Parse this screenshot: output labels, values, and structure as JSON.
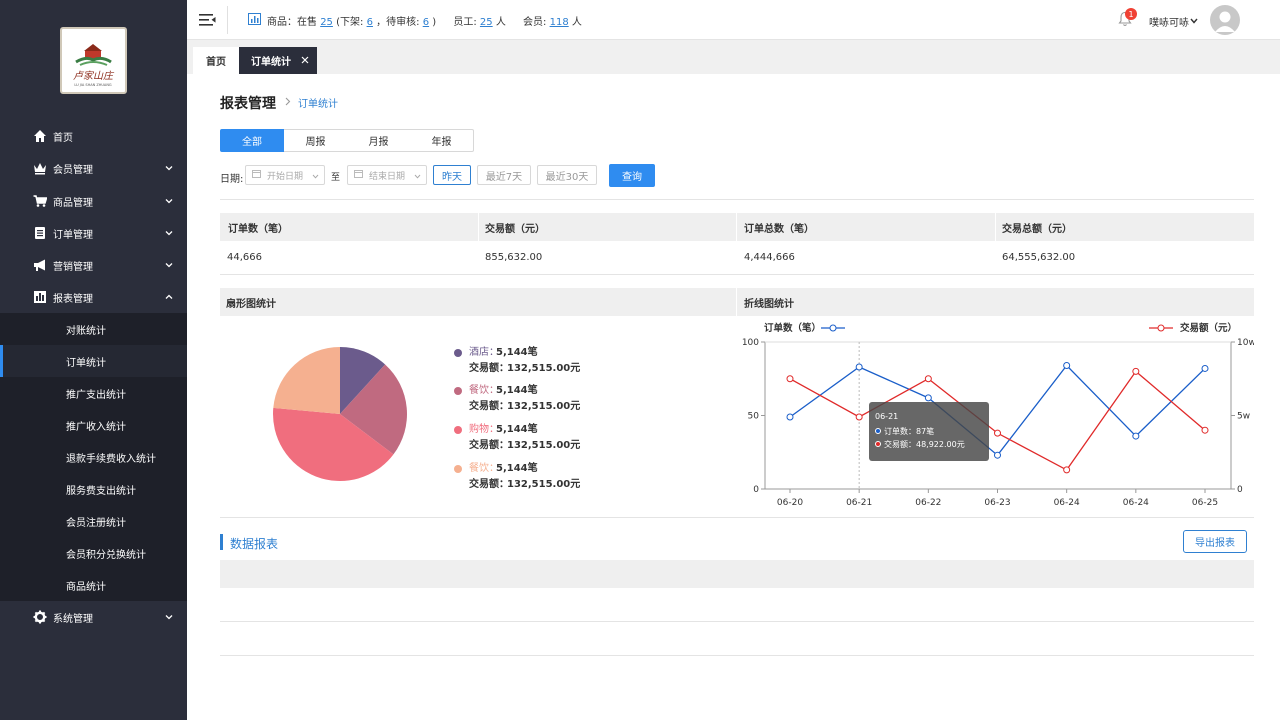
{
  "sidebar": {
    "logo_alt": "卢家山庄",
    "items": [
      {
        "label": "首页",
        "icon": "home-icon"
      },
      {
        "label": "会员管理",
        "icon": "crown-icon"
      },
      {
        "label": "商品管理",
        "icon": "cart-icon"
      },
      {
        "label": "订单管理",
        "icon": "list-icon"
      },
      {
        "label": "营销管理",
        "icon": "megaphone-icon"
      },
      {
        "label": "报表管理",
        "icon": "bar-chart-icon"
      }
    ],
    "subitems": [
      "对账统计",
      "订单统计",
      "推广支出统计",
      "推广收入统计",
      "退款手续费收入统计",
      "服务费支出统计",
      "会员注册统计",
      "会员积分兑换统计",
      "商品统计"
    ],
    "system": {
      "label": "系统管理",
      "icon": "gear-icon"
    }
  },
  "topbar": {
    "goods_label": "商品：在售",
    "on_sale": "25",
    "off_label": "(下架:",
    "off_count": "6",
    "pending_label": "，待审核:",
    "pending_count": "6",
    "close_paren": ")",
    "staff_label": "员工:",
    "staff_count": "25",
    "staff_unit": "人",
    "member_label": "会员:",
    "member_count": "118",
    "member_unit": "人",
    "badge": "1",
    "username": "噗哧可哧"
  },
  "tabs": {
    "home": "首页",
    "current": "订单统计"
  },
  "breadcrumb": {
    "root": "报表管理",
    "current": "订单统计"
  },
  "period": [
    "全部",
    "周报",
    "月报",
    "年报"
  ],
  "filter": {
    "date_label": "日期:",
    "start_placeholder": "开始日期",
    "to": "至",
    "end_placeholder": "结束日期",
    "yesterday": "昨天",
    "last7": "最近7天",
    "last30": "最近30天",
    "query": "查询"
  },
  "summary": {
    "headers": [
      "订单数（笔）",
      "交易额（元）",
      "订单总数（笔）",
      "交易总额（元）"
    ],
    "values": [
      "44,666",
      "855,632.00",
      "4,444,666",
      "64,555,632.00"
    ]
  },
  "pie_section": {
    "title": "扇形图统计",
    "legend": [
      {
        "name": "酒店：",
        "count": "5,144笔",
        "amount_label": "交易额：",
        "amount": "132,515.00元",
        "color": "#6b5b8c"
      },
      {
        "name": "餐饮：",
        "count": "5,144笔",
        "amount_label": "交易额：",
        "amount": "132,515.00元",
        "color": "#c06a80"
      },
      {
        "name": "购物：",
        "count": "5,144笔",
        "amount_label": "交易额：",
        "amount": "132,515.00元",
        "color": "#f06e7e"
      },
      {
        "name": "餐饮：",
        "count": "5,144笔",
        "amount_label": "交易额：",
        "amount": "132,515.00元",
        "color": "#f5b090"
      }
    ]
  },
  "line_section": {
    "title": "折线图统计",
    "tooltip": {
      "date": "06-21",
      "orders": "订单数：87笔",
      "amount": "交易额：48,922.00元"
    }
  },
  "chart_data": [
    {
      "type": "pie",
      "slices": [
        {
          "name": "酒店",
          "value": 1
        },
        {
          "name": "餐饮",
          "value": 2
        },
        {
          "name": "购物",
          "value": 3.5
        },
        {
          "name": "餐饮",
          "value": 2
        }
      ],
      "colors": [
        "#6b5b8c",
        "#c06a80",
        "#f06e7e",
        "#f5b090"
      ]
    },
    {
      "type": "line",
      "categories": [
        "06-20",
        "06-21",
        "06-22",
        "06-23",
        "06-24",
        "06-24",
        "06-25"
      ],
      "series": [
        {
          "name": "订单数（笔）",
          "values": [
            49,
            83,
            62,
            23,
            84,
            36,
            82
          ],
          "color": "#1a5ec9",
          "axis": "left"
        },
        {
          "name": "交易额（元）",
          "values": [
            7.5,
            4.9,
            7.5,
            3.8,
            1.3,
            8,
            4
          ],
          "color": "#e02a2a",
          "axis": "right"
        }
      ],
      "ylim_left": [
        0,
        100
      ],
      "yticks_left": [
        "0",
        "50",
        "100"
      ],
      "ylim_right": [
        0,
        10
      ],
      "yticks_right": [
        "0",
        "5w",
        "10w"
      ],
      "grid": false
    }
  ],
  "report": {
    "title": "数据报表",
    "export": "导出报表"
  }
}
